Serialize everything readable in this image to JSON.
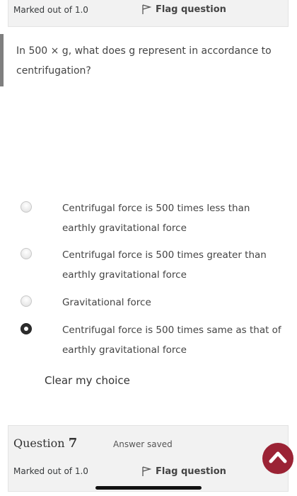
{
  "previous_question": {
    "marked_out_of": "Marked out of 1.0",
    "flag_label": "Flag question"
  },
  "question": {
    "text": "In 500 × g, what does g represent in accordance to centrifugation?",
    "options": [
      {
        "label": "Centrifugal force is 500 times less than earthly gravitational force",
        "selected": false
      },
      {
        "label": "Centrifugal force is 500 times greater than earthly gravitational force",
        "selected": false
      },
      {
        "label": "Gravitational force",
        "selected": false
      },
      {
        "label": "Centrifugal force is 500 times same as that of earthly gravitational force",
        "selected": true
      }
    ],
    "clear_label": "Clear my choice"
  },
  "next_question": {
    "prefix": "Question",
    "number": "7",
    "status": "Answer saved",
    "marked_out_of": "Marked out of 1.0",
    "flag_label": "Flag question"
  },
  "colors": {
    "accent": "#9b2335",
    "info_bg": "#f2f2f2"
  },
  "icons": {
    "flag": "flag-icon",
    "back_to_top": "chevron-up-icon"
  }
}
